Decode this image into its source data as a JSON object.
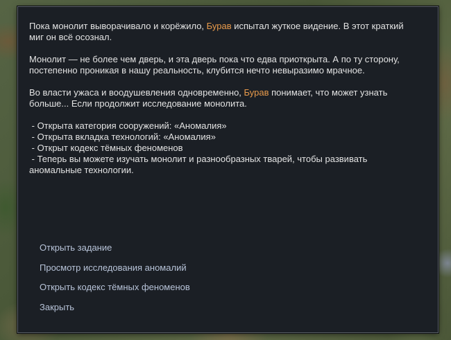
{
  "event": {
    "paragraph1": {
      "before": "Пока монолит выворачивало и корёжило, ",
      "name": "Бурав",
      "after": " испытал жуткое видение. В этот краткий миг он всё осознал."
    },
    "paragraph2": "Монолит — не более чем дверь, и эта дверь пока что едва приоткрыта. А по ту сторону, постепенно проникая в нашу реальность, клубится нечто невыразимо мрачное.",
    "paragraph3": {
      "before": "Во власти ужаса и воодушевления одновременно, ",
      "name": "Бурав",
      "after": " понимает, что может узнать больше... Если продолжит исследование монолита."
    },
    "bullets": [
      " - Открыта категория сооружений: «Аномалия»",
      " - Открыта вкладка технологий: «Аномалия»",
      " - Открыт кодекс тёмных феноменов",
      " - Теперь вы можете изучать монолит и разнообразных тварей, чтобы развивать аномальные технологии."
    ],
    "highlight_color": "#e89a4b"
  },
  "options": [
    "Открыть задание",
    "Просмотр исследования аномалий",
    "Открыть кодекс тёмных феноменов",
    "Закрыть"
  ]
}
